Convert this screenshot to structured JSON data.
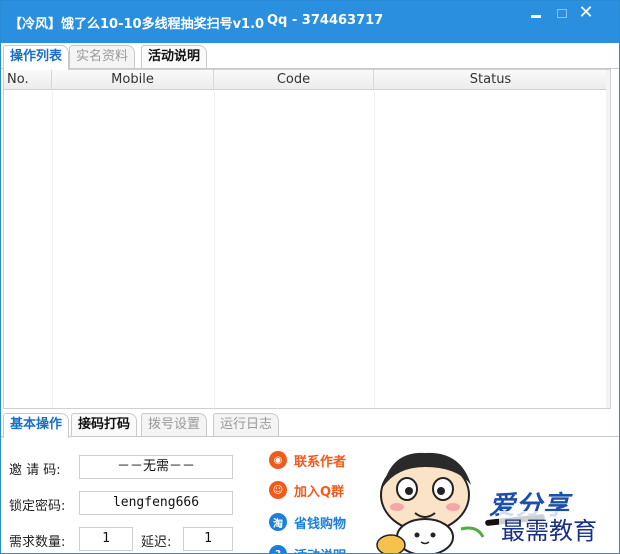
{
  "window": {
    "title": "【冷风】饿了么10-10多线程抽奖扫号v1.0",
    "contact": "Qq - 374463717",
    "controls": {
      "minimize": "",
      "maximize": "",
      "close": "✕"
    }
  },
  "top_tabs": [
    {
      "label": "操作列表",
      "active": true
    },
    {
      "label": "实名资料",
      "active": false
    },
    {
      "label": "活动说明",
      "active": false
    }
  ],
  "grid": {
    "columns": [
      "No.",
      "Mobile",
      "Code",
      "Status"
    ],
    "rows": []
  },
  "bottom_tabs": [
    {
      "label": "基本操作",
      "active": true
    },
    {
      "label": "接码打码",
      "active": false
    },
    {
      "label": "拨号设置",
      "active": false
    },
    {
      "label": "运行日志",
      "active": false
    }
  ],
  "form": {
    "invite_label": "邀 请 码:",
    "invite_value": "－－无需－－",
    "password_label": "锁定密码:",
    "password_value": "lengfeng666",
    "quantity_label": "需求数量:",
    "quantity_value": "1",
    "delay_label": "延迟:",
    "delay_value": "1"
  },
  "links": [
    {
      "label": "联系作者",
      "icon": "qq-icon",
      "color": "#f05a1a"
    },
    {
      "label": "加入Q群",
      "icon": "group-icon",
      "color": "#f05a1a"
    },
    {
      "label": "省钱购物",
      "icon": "taobao-icon",
      "color": "#1e7fd8"
    },
    {
      "label": "活动说明",
      "icon": "info-icon",
      "color": "#1e7fd8"
    }
  ],
  "branding": {
    "logo": "爱分享",
    "watermark": "最需教育"
  },
  "colors": {
    "titlebar": "#2b8fe0",
    "active_tab": "#1a6fc8"
  }
}
